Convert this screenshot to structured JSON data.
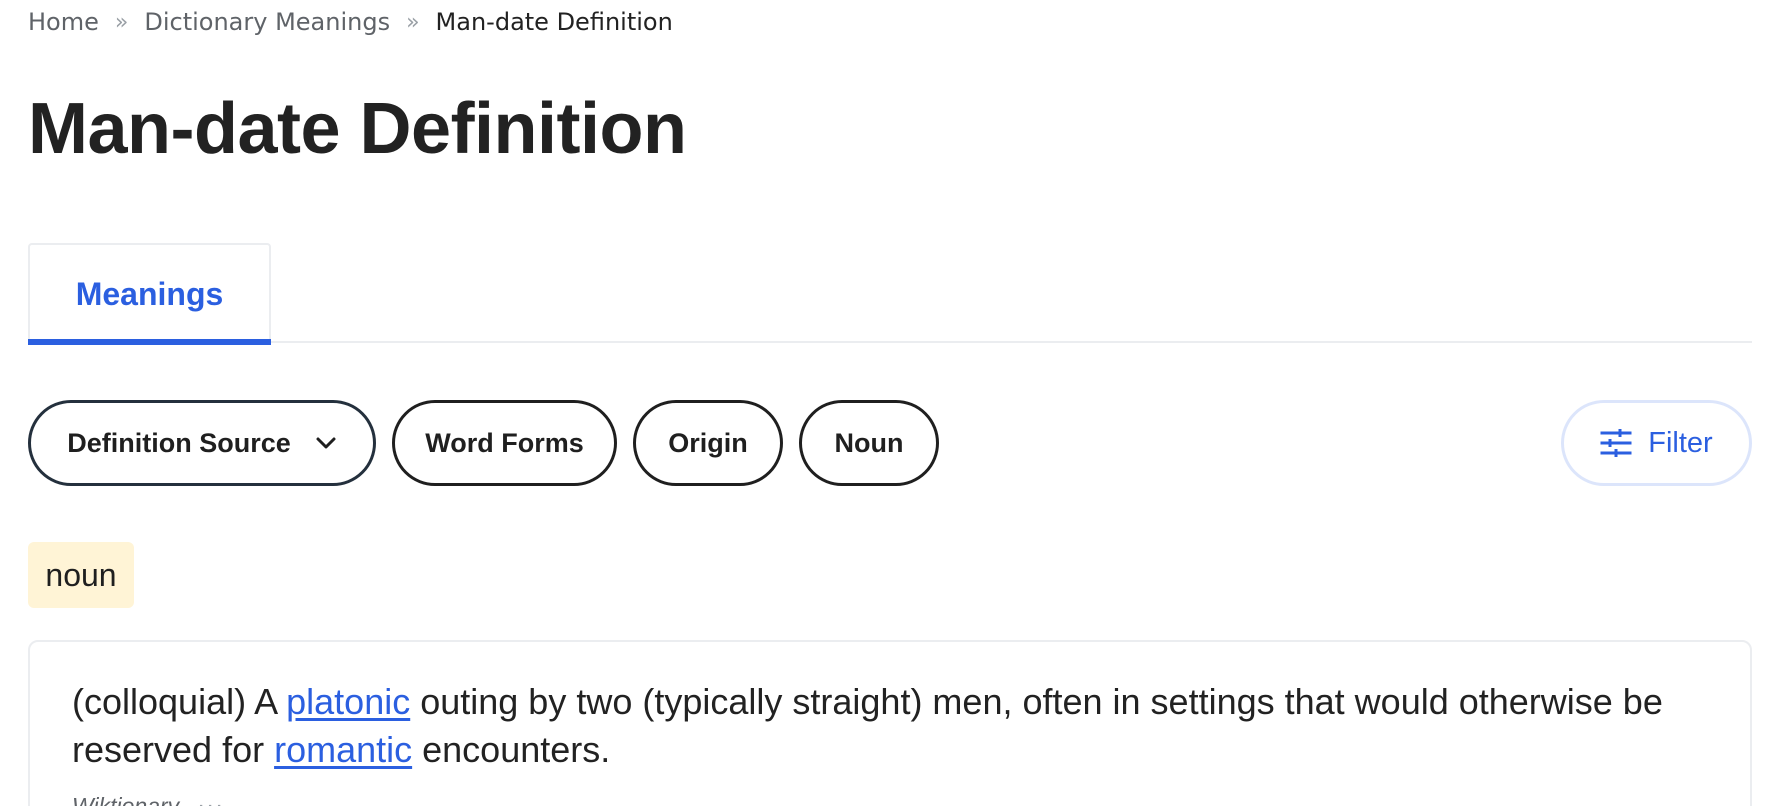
{
  "breadcrumb": {
    "home": "Home",
    "separator": "»",
    "section": "Dictionary Meanings",
    "current": "Man-date Definition"
  },
  "page_title": "Man-date Definition",
  "tabs": [
    {
      "label": "Meanings",
      "active": true
    }
  ],
  "chips": {
    "definition_source": "Definition Source",
    "word_forms": "Word Forms",
    "origin": "Origin",
    "noun": "Noun"
  },
  "filter": {
    "label": "Filter",
    "icon": "sliders-icon"
  },
  "part_of_speech": "noun",
  "definition": {
    "prefix": "(colloquial) A ",
    "link1": "platonic",
    "middle": " outing by two (typically straight) men, often in settings that would otherwise be reserved for ",
    "link2": "romantic",
    "suffix": " encounters.",
    "source": "Wiktionary",
    "more": "···"
  },
  "colors": {
    "accent": "#2b5fe0",
    "badge_bg": "#fff4d6",
    "text": "#222222"
  }
}
